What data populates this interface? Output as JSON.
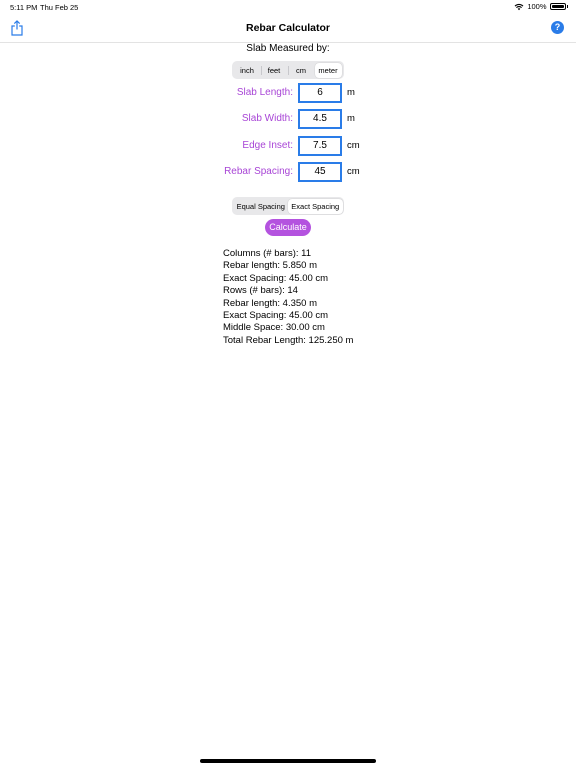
{
  "status_bar": {
    "time": "5:11 PM",
    "date": "Thu Feb 25",
    "battery": "100%",
    "battery_level": 1.0,
    "icons": [
      "wifi-icon",
      "battery-icon"
    ]
  },
  "nav": {
    "title": "Rebar Calculator",
    "share_icon": "share-icon",
    "help_label": "?"
  },
  "units": {
    "label": "Slab Measured by:",
    "options": [
      "inch",
      "feet",
      "cm",
      "meter"
    ],
    "selected": "meter"
  },
  "fields": [
    {
      "label": "Slab Length:",
      "value": "6",
      "unit": "m"
    },
    {
      "label": "Slab Width:",
      "value": "4.5",
      "unit": "m"
    },
    {
      "label": "Edge Inset:",
      "value": "7.5",
      "unit": "cm"
    },
    {
      "label": "Rebar Spacing:",
      "value": "45",
      "unit": "cm"
    }
  ],
  "spacing_mode": {
    "options": [
      "Equal Spacing",
      "Exact Spacing"
    ],
    "selected": "Exact Spacing"
  },
  "calculate_label": "Calculate",
  "results": [
    "Columns (# bars): 11",
    "Rebar length: 5.850 m",
    "Exact Spacing: 45.00 cm",
    "Rows (# bars): 14",
    "Rebar length: 4.350 m",
    "Exact Spacing: 45.00 cm",
    "Middle Space: 30.00 cm",
    "Total Rebar Length: 125.250 m"
  ],
  "colors": {
    "accent_blue": "#2a7ce8",
    "label_purple": "#a845d6",
    "button_purple": "#b453df"
  }
}
